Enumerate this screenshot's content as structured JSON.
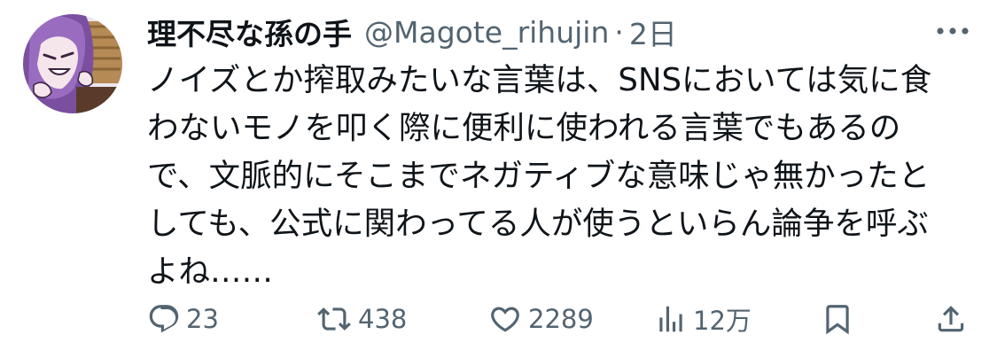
{
  "tweet": {
    "author": {
      "display_name": "理不尽な孫の手",
      "handle": "@Magote_rihujin",
      "separator": "·",
      "time": "2日"
    },
    "text_lines": [
      "ノイズとか搾取みたいな言葉は、SNSにおいては気に食",
      "わないモノを叩く際に便利に使われる言葉でもあるの",
      "で、文脈的にそこまでネガティブな意味じゃ無かったと",
      "しても、公式に関わってる人が使うといらん論争を呼ぶ",
      "よね……"
    ],
    "actions": {
      "replies": "23",
      "retweets": "438",
      "likes": "2289",
      "views": "12万"
    },
    "colors": {
      "text": "#0f1419",
      "secondary": "#536471",
      "background": "#ffffff",
      "avatar_purple": "#7b4fa0"
    },
    "icons": {
      "reply": "reply-icon",
      "retweet": "retweet-icon",
      "like": "heart-icon",
      "views": "views-icon",
      "bookmark": "bookmark-icon",
      "share": "share-icon",
      "more": "more-icon"
    }
  }
}
